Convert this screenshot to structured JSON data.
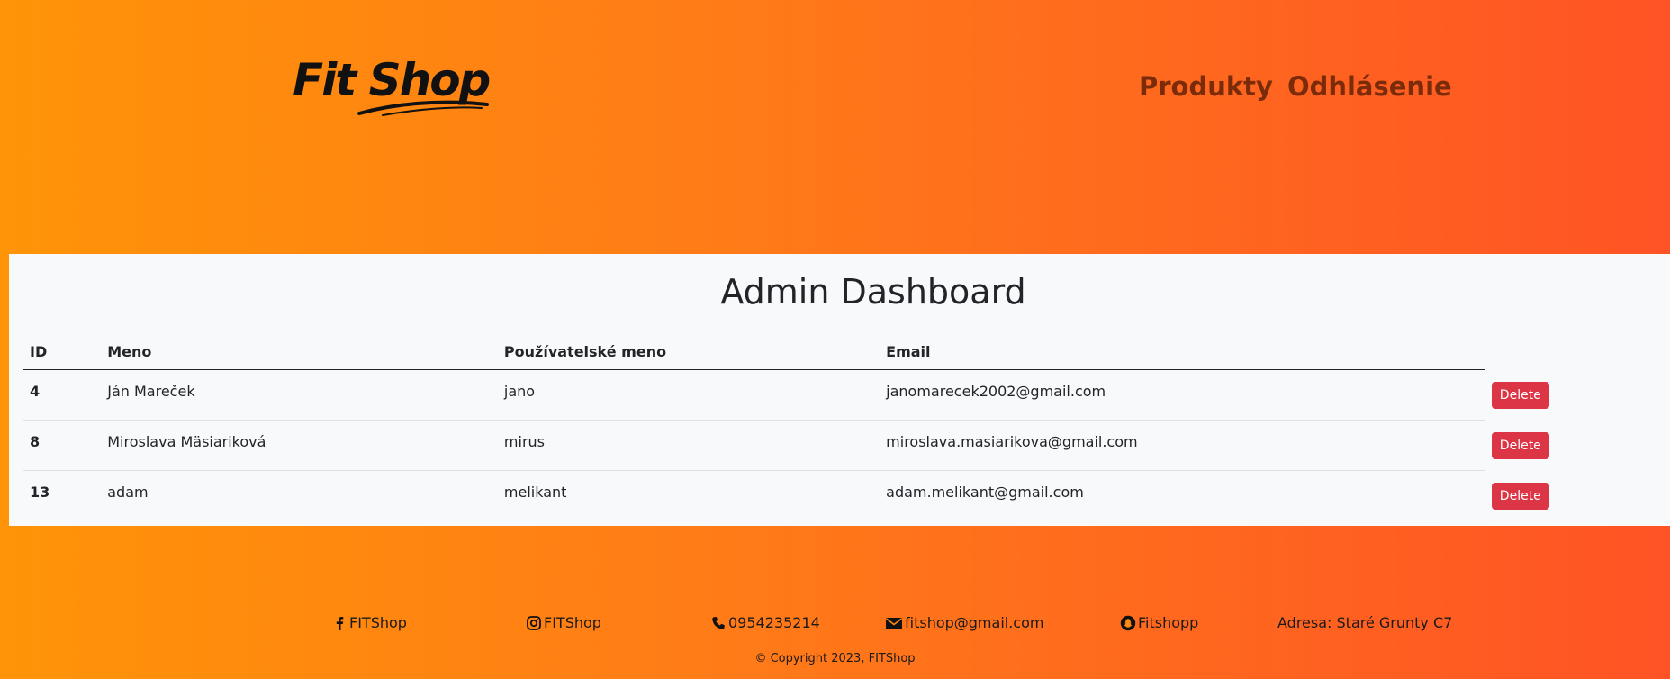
{
  "header": {
    "logo_text": "Fit Shop",
    "nav": [
      {
        "label": "Produkty"
      },
      {
        "label": "Odhlásenie"
      }
    ]
  },
  "main": {
    "title": "Admin Dashboard",
    "columns": [
      "ID",
      "Meno",
      "Používatelské meno",
      "Email"
    ],
    "rows": [
      {
        "id": "4",
        "name": "Ján Mareček",
        "username": "jano",
        "email": "janomarecek2002@gmail.com",
        "action": "Delete"
      },
      {
        "id": "8",
        "name": "Miroslava Mäsiariková",
        "username": "mirus",
        "email": "miroslava.masiarikova@gmail.com",
        "action": "Delete"
      },
      {
        "id": "13",
        "name": "adam",
        "username": "melikant",
        "email": "adam.melikant@gmail.com",
        "action": "Delete"
      }
    ]
  },
  "footer": {
    "facebook": "FITShop",
    "instagram": "FITShop",
    "phone": "0954235214",
    "email": "fitshop@gmail.com",
    "snapchat": "Fitshopp",
    "address": "Adresa: Staré Grunty C7",
    "copyright": "© Copyright 2023, FITShop"
  },
  "colors": {
    "gradient_start": "#ff9408",
    "gradient_end": "#ff5325",
    "nav_text": "#7a2b0a",
    "delete_button": "#dc3545",
    "panel_bg": "#f8f9fa"
  }
}
